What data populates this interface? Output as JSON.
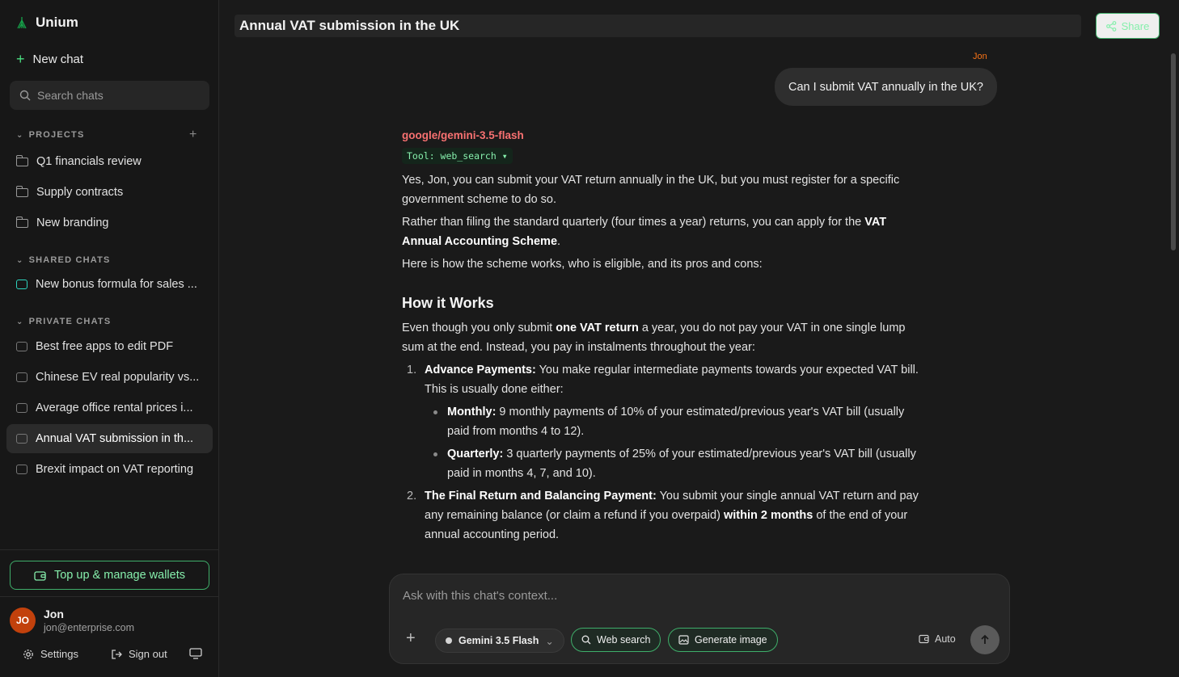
{
  "app": {
    "name": "Unium"
  },
  "sidebar": {
    "new_chat": "New chat",
    "search_placeholder": "Search chats",
    "projects_title": "PROJECTS",
    "projects": [
      {
        "label": "Q1 financials review"
      },
      {
        "label": "Supply contracts"
      },
      {
        "label": "New branding"
      }
    ],
    "shared_title": "SHARED CHATS",
    "shared": [
      {
        "label": "New bonus formula for sales ..."
      }
    ],
    "private_title": "PRIVATE CHATS",
    "private": [
      {
        "label": "Best free apps to edit PDF"
      },
      {
        "label": "Chinese EV real popularity vs..."
      },
      {
        "label": "Average office rental prices i..."
      },
      {
        "label": "Annual VAT submission in th..."
      },
      {
        "label": "Brexit impact on VAT reporting"
      }
    ],
    "wallet_button": "Top up & manage wallets",
    "user": {
      "initials": "JO",
      "name": "Jon",
      "email": "jon@enterprise.com"
    },
    "settings": "Settings",
    "sign_out": "Sign out"
  },
  "header": {
    "title": "Annual VAT submission in the UK",
    "share": "Share"
  },
  "conversation": {
    "user_name": "Jon",
    "user_message": "Can I submit VAT annually in the UK?",
    "model": "google/gemini-3.5-flash",
    "tool": "Tool: web_search ▾",
    "p1": "Yes, Jon, you can submit your VAT return annually in the UK, but you must register for a specific government scheme to do so.",
    "p2_a": "Rather than filing the standard quarterly (four times a year) returns, you can apply for the ",
    "p2_b": "VAT Annual Accounting Scheme",
    "p2_c": ".",
    "p3": "Here is how the scheme works, who is eligible, and its pros and cons:",
    "heading": "How it Works",
    "p4_a": "Even though you only submit ",
    "p4_b": "one VAT return",
    "p4_c": " a year, you do not pay your VAT in one single lump sum at the end. Instead, you pay in instalments throughout the year:",
    "step1_num": "1.",
    "step1_b": "Advance Payments:",
    "step1_t": " You make regular intermediate payments towards your expected VAT bill. This is usually done either:",
    "sub1_b": "Monthly:",
    "sub1_t": " 9 monthly payments of 10% of your estimated/previous year's VAT bill (usually paid from months 4 to 12).",
    "sub2_b": "Quarterly:",
    "sub2_t": " 3 quarterly payments of 25% of your estimated/previous year's VAT bill (usually paid in months 4, 7, and 10).",
    "step2_num": "2.",
    "step2_b": "The Final Return and Balancing Payment:",
    "step2_t1": " You submit your single annual VAT return and pay any remaining balance (or claim a refund if you overpaid) ",
    "step2_b2": "within 2 months",
    "step2_t2": " of the end of your annual accounting period."
  },
  "composer": {
    "placeholder": "Ask with this chat's context...",
    "model": "Gemini 3.5 Flash",
    "web_search": "Web search",
    "generate_image": "Generate image",
    "auto": "Auto"
  },
  "colors": {
    "accent": "#3fae6a",
    "model_name": "#f87171",
    "user_tag": "#f97316",
    "avatar": "#c2410c"
  }
}
